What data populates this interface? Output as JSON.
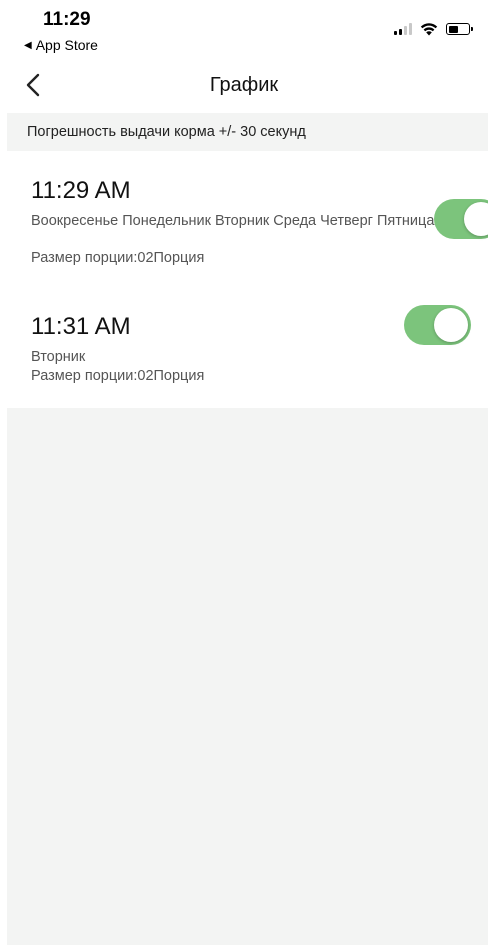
{
  "status_bar": {
    "time": "11:29",
    "back_app_label": "App Store",
    "icons": [
      "signal-icon",
      "wifi-icon",
      "battery-icon"
    ]
  },
  "nav": {
    "title": "График",
    "back_icon": "chevron-left-icon"
  },
  "notice": "Погрешность выдачи корма +/- 30 секунд",
  "schedules": [
    {
      "time": "11:29 AM",
      "days": "Воокресенье Понедельник Вторник Среда Четверг Пятница",
      "portion": "Размер порции:02Порция",
      "enabled": true
    },
    {
      "time": "11:31 AM",
      "days": "Вторник",
      "portion": "Размер порции:02Порция",
      "enabled": true
    }
  ],
  "colors": {
    "toggle_on": "#7cc47c",
    "section_bg": "#f3f4f3"
  }
}
